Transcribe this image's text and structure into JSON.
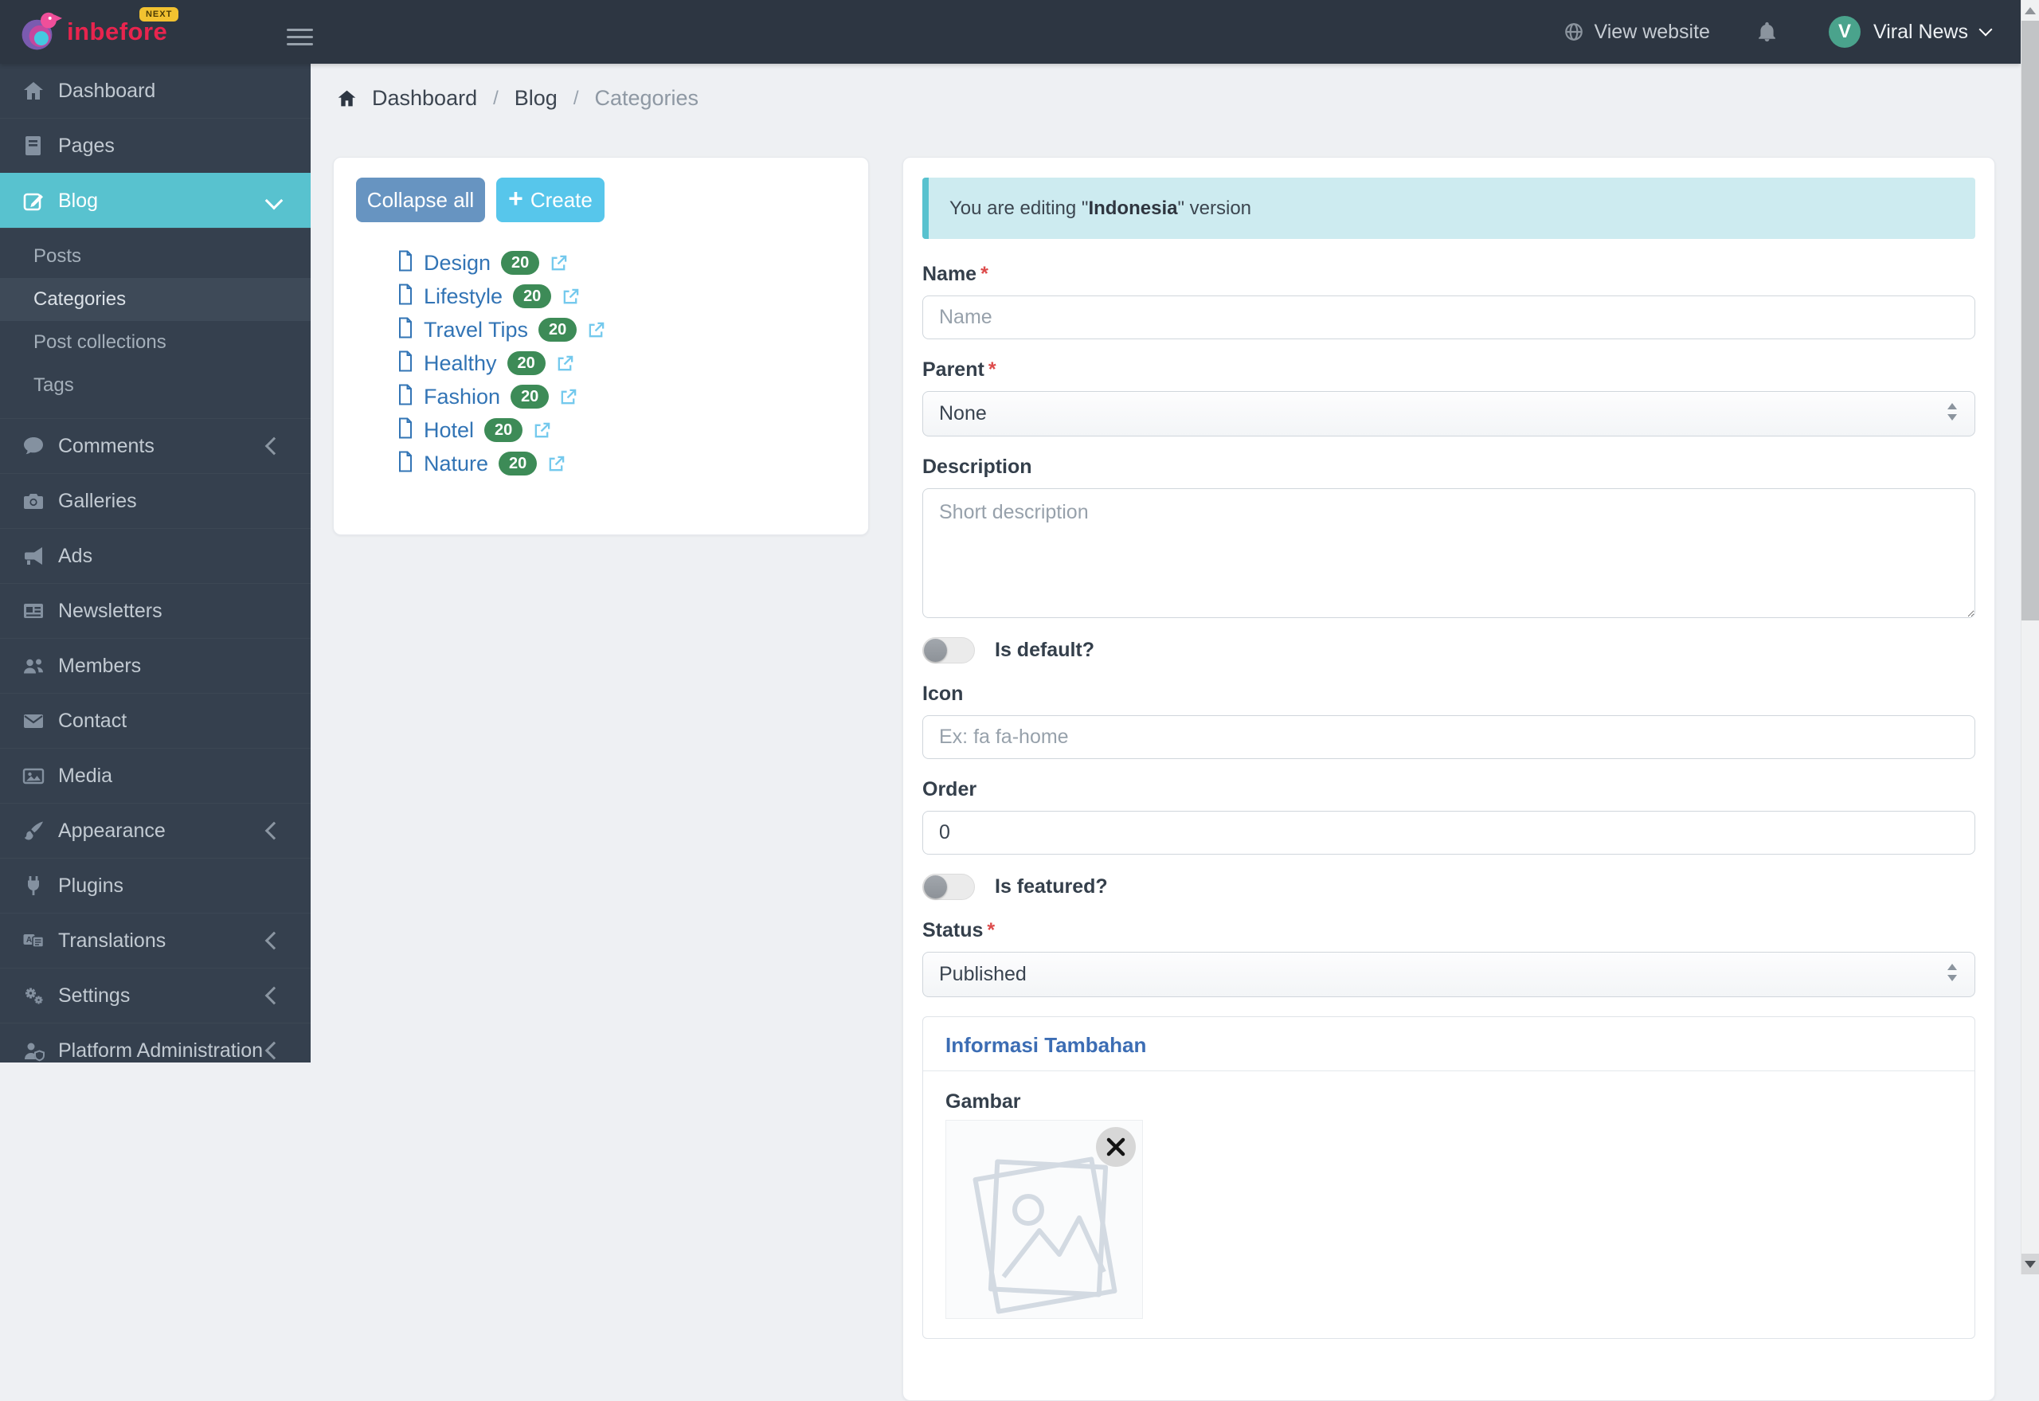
{
  "header": {
    "logo_text": "inbefore",
    "logo_badge": "NEXT",
    "view_website": "View website",
    "account_initial": "V",
    "account_name": "Viral News"
  },
  "sidebar": {
    "items": [
      {
        "label": "Dashboard",
        "icon": "home"
      },
      {
        "label": "Pages",
        "icon": "book"
      },
      {
        "label": "Blog",
        "icon": "edit-square",
        "expanded": true,
        "active": true,
        "children": [
          {
            "label": "Posts"
          },
          {
            "label": "Categories",
            "active": true
          },
          {
            "label": "Post collections"
          },
          {
            "label": "Tags"
          }
        ]
      },
      {
        "label": "Comments",
        "icon": "chat-bubble",
        "collapsible": true
      },
      {
        "label": "Galleries",
        "icon": "camera"
      },
      {
        "label": "Ads",
        "icon": "megaphone"
      },
      {
        "label": "Newsletters",
        "icon": "newspaper"
      },
      {
        "label": "Members",
        "icon": "users"
      },
      {
        "label": "Contact",
        "icon": "envelope"
      },
      {
        "label": "Media",
        "icon": "image"
      },
      {
        "label": "Appearance",
        "icon": "paintbrush",
        "collapsible": true
      },
      {
        "label": "Plugins",
        "icon": "plug"
      },
      {
        "label": "Translations",
        "icon": "language",
        "collapsible": true
      },
      {
        "label": "Settings",
        "icon": "gears",
        "collapsible": true
      },
      {
        "label": "Platform Administration",
        "icon": "user-shield",
        "collapsible": true
      }
    ]
  },
  "breadcrumb": {
    "separator": "/",
    "items": [
      "Dashboard",
      "Blog",
      "Categories"
    ]
  },
  "tree": {
    "collapse_all_label": "Collapse all",
    "create_icon": "+",
    "create_label": "Create",
    "items": [
      {
        "name": "Design",
        "count": "20"
      },
      {
        "name": "Lifestyle",
        "count": "20"
      },
      {
        "name": "Travel Tips",
        "count": "20"
      },
      {
        "name": "Healthy",
        "count": "20"
      },
      {
        "name": "Fashion",
        "count": "20"
      },
      {
        "name": "Hotel",
        "count": "20"
      },
      {
        "name": "Nature",
        "count": "20"
      }
    ]
  },
  "form": {
    "required_mark": "*",
    "notice": {
      "prefix": "You are editing \"",
      "language": "Indonesia",
      "suffix": "\" version"
    },
    "name": {
      "label": "Name",
      "placeholder": "Name",
      "value": ""
    },
    "parent": {
      "label": "Parent",
      "value": "None"
    },
    "description": {
      "label": "Description",
      "placeholder": "Short description",
      "value": ""
    },
    "is_default": {
      "label": "Is default?",
      "state": "off"
    },
    "icon": {
      "label": "Icon",
      "placeholder": "Ex: fa fa-home",
      "value": ""
    },
    "order": {
      "label": "Order",
      "value": "0"
    },
    "is_featured": {
      "label": "Is featured?",
      "state": "off"
    },
    "status": {
      "label": "Status",
      "value": "Published"
    },
    "additional": {
      "title": "Informasi Tambahan",
      "image_label": "Gambar"
    }
  },
  "colors": {
    "header_bg": "#2d3642",
    "sidebar_bg": "#35404e",
    "accent_teal": "#58c2cf",
    "badge_green": "#3d8b57",
    "link_blue": "#3274b5",
    "button_blue": "#6794c1",
    "button_cyan": "#57c6eb",
    "avatar_green": "#4aa38c",
    "alert_bg": "#cdebf0",
    "info_title_blue": "#3c6db4",
    "required_red": "#dd4b4b",
    "page_bg": "#eef0f3"
  }
}
